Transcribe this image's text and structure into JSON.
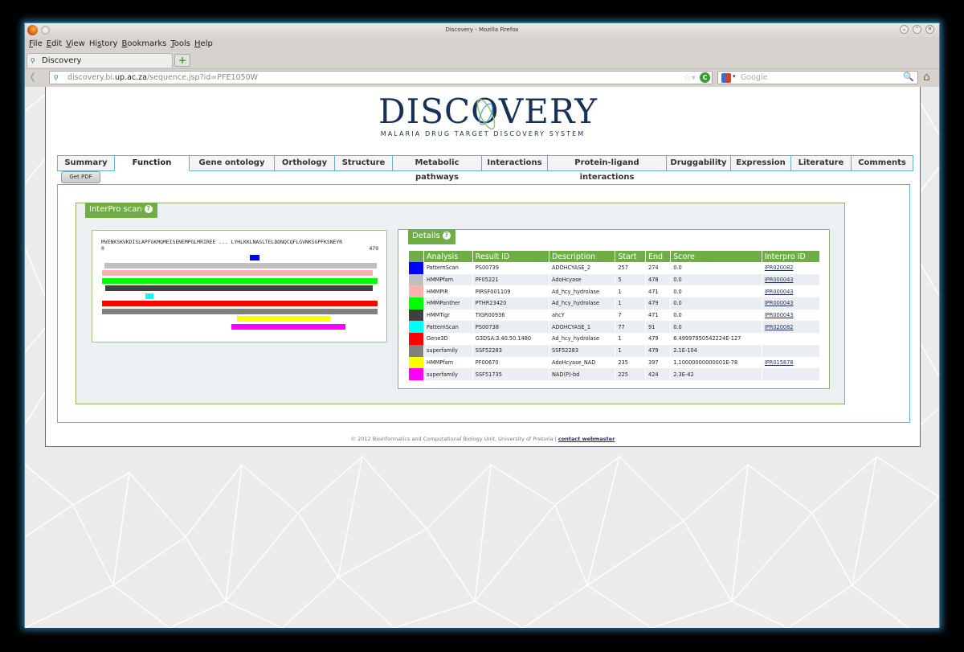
{
  "browser": {
    "window_title": "Discovery - Mozilla Firefox",
    "menu": [
      "File",
      "Edit",
      "View",
      "History",
      "Bookmarks",
      "Tools",
      "Help"
    ],
    "menu_access": [
      "F",
      "E",
      "V",
      "s",
      "B",
      "T",
      "H"
    ],
    "tab_title": "Discovery",
    "url_prefix": "discovery.bi.",
    "url_domain": "up.ac.za",
    "url_path": "/sequence.jsp?id=PFE1050W",
    "search_placeholder": "Google"
  },
  "site": {
    "logo_title": "DISCOVERY",
    "logo_subtitle": "MALARIA DRUG TARGET DISCOVERY SYSTEM",
    "tabs": [
      {
        "label": "Summary",
        "active": false
      },
      {
        "label": "Function",
        "active": true
      },
      {
        "label": "Gene ontology",
        "active": false
      },
      {
        "label": "Orthology",
        "active": false
      },
      {
        "label": "Structure",
        "active": false
      },
      {
        "label": "Metabolic pathways",
        "active": false
      },
      {
        "label": "Interactions",
        "active": false
      },
      {
        "label": "Protein-ligand interactions",
        "active": false
      },
      {
        "label": "Druggability",
        "active": false
      },
      {
        "label": "Expression",
        "active": false
      },
      {
        "label": "Literature",
        "active": false
      },
      {
        "label": "Comments",
        "active": false
      }
    ],
    "get_pdf": "Get PDF"
  },
  "interpro": {
    "title": "InterPro scan",
    "help": "?",
    "sequence_display": "MVENKSKVKDISLAPFGKMQMEISENEMPGLMRIREE ... LYHLKKLNASLTELDDNQCQFLGVNKSGPFKSNEYR",
    "seq_start": "0",
    "seq_end": "479",
    "seq_length": 479
  },
  "details": {
    "title": "Details",
    "help": "?",
    "columns": [
      "",
      "Analysis",
      "Result ID",
      "Description",
      "Start",
      "End",
      "Score",
      "Interpro ID"
    ],
    "rows": [
      {
        "color": "#0000ff",
        "analysis": "PatternScan",
        "result_id": "PS00739",
        "description": "ADOHCYASE_2",
        "start": 257,
        "end": 274,
        "score": "0.0",
        "interpro_id": "IPR020082"
      },
      {
        "color": "#c0c0c0",
        "analysis": "HMMPfam",
        "result_id": "PF05221",
        "description": "AdoHcyase",
        "start": 5,
        "end": 478,
        "score": "0.0",
        "interpro_id": "IPR000043"
      },
      {
        "color": "#ffb0b0",
        "analysis": "HMMPIR",
        "result_id": "PIRSF001109",
        "description": "Ad_hcy_hydrolase",
        "start": 1,
        "end": 471,
        "score": "0.0",
        "interpro_id": "IPR000043"
      },
      {
        "color": "#00ff00",
        "analysis": "HMMPanther",
        "result_id": "PTHR23420",
        "description": "Ad_hcy_hydrolase",
        "start": 1,
        "end": 479,
        "score": "0.0",
        "interpro_id": "IPR000043"
      },
      {
        "color": "#404040",
        "analysis": "HMMTigr",
        "result_id": "TIGR00936",
        "description": "ahcY",
        "start": 7,
        "end": 471,
        "score": "0.0",
        "interpro_id": "IPR000043"
      },
      {
        "color": "#00ffff",
        "analysis": "PatternScan",
        "result_id": "PS00738",
        "description": "ADOHCYASE_1",
        "start": 77,
        "end": 91,
        "score": "0.0",
        "interpro_id": "IPR020082"
      },
      {
        "color": "#ff0000",
        "analysis": "Gene3D",
        "result_id": "G3DSA:3.40.50.1480",
        "description": "Ad_hcy_hydrolase",
        "start": 1,
        "end": 479,
        "score": "6.49997950542224E-127",
        "interpro_id": ""
      },
      {
        "color": "#808080",
        "analysis": "superfamily",
        "result_id": "SSF52283",
        "description": "SSF52283",
        "start": 1,
        "end": 479,
        "score": "2.1E-104",
        "interpro_id": ""
      },
      {
        "color": "#ffff00",
        "analysis": "HMMPfam",
        "result_id": "PF00670",
        "description": "AdoHcyase_NAD",
        "start": 235,
        "end": 397,
        "score": "1.10000000000001E-78",
        "interpro_id": "IPR015878"
      },
      {
        "color": "#ff00ff",
        "analysis": "superfamily",
        "result_id": "SSF51735",
        "description": "NAD(P)-bd",
        "start": 225,
        "end": 424,
        "score": "2.3E-42",
        "interpro_id": ""
      }
    ]
  },
  "footer": {
    "text": "© 2012 Bioinformatics and Computational Biology Unit, University of Pretoria | ",
    "link": "contact webmaster"
  }
}
